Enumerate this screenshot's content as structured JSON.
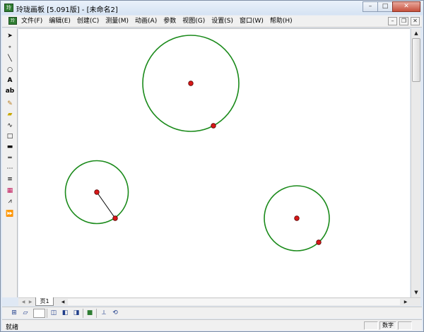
{
  "window": {
    "title": "玲珑画板 [5.091版] - [未命名2]",
    "app_icon": "app-logo-icon",
    "controls": [
      "minimize-icon",
      "maximize-icon",
      "close-icon"
    ]
  },
  "menubar": {
    "items": [
      {
        "label": "文件(F)"
      },
      {
        "label": "编辑(E)"
      },
      {
        "label": "创建(C)"
      },
      {
        "label": "测量(M)"
      },
      {
        "label": "动画(A)"
      },
      {
        "label": "参数"
      },
      {
        "label": "视图(G)"
      },
      {
        "label": "设置(S)"
      },
      {
        "label": "窗口(W)"
      },
      {
        "label": "帮助(H)"
      }
    ]
  },
  "toolbox": {
    "tools": [
      {
        "name": "select-arrow-icon",
        "glyph": "➤"
      },
      {
        "name": "point-tool-icon",
        "glyph": "∘"
      },
      {
        "name": "line-tool-icon",
        "glyph": "╲"
      },
      {
        "name": "circle-tool-icon",
        "glyph": "○"
      },
      {
        "name": "text-tool-icon",
        "glyph": "A"
      },
      {
        "name": "label-tool-icon",
        "glyph": "ab"
      },
      {
        "name": "pencil-tool-icon",
        "glyph": "✎"
      },
      {
        "name": "eraser-tool-icon",
        "glyph": "▰"
      },
      {
        "name": "polyline-tool-icon",
        "glyph": "∿"
      },
      {
        "name": "rectangle-tool-icon",
        "glyph": "□"
      },
      {
        "name": "thick-line-icon",
        "glyph": "▬"
      },
      {
        "name": "double-line-icon",
        "glyph": "═"
      },
      {
        "name": "dotted-line-icon",
        "glyph": "⋯"
      },
      {
        "name": "triple-line-icon",
        "glyph": "≡"
      },
      {
        "name": "color-palette-icon",
        "glyph": "▦"
      },
      {
        "name": "function-graph-icon",
        "glyph": "⩘"
      },
      {
        "name": "animation-play-icon",
        "glyph": "⏩"
      }
    ]
  },
  "canvas": {
    "circle_color": "#1a8a1a",
    "point_color": "#d81818"
  },
  "page_tabs": {
    "active": "页1"
  },
  "bottom_toolbar": {
    "tools": [
      {
        "name": "grid-icon",
        "glyph": "⊞"
      },
      {
        "name": "parallelogram-icon",
        "glyph": "▱"
      },
      {
        "name": "cube-front-icon",
        "glyph": "◫"
      },
      {
        "name": "cube-side-icon",
        "glyph": "◧"
      },
      {
        "name": "cube-top-icon",
        "glyph": "◨"
      },
      {
        "name": "fill-color-icon",
        "glyph": "■"
      },
      {
        "name": "coordinate-axes-icon",
        "glyph": "⟂"
      },
      {
        "name": "transform-icon",
        "glyph": "⟲"
      }
    ]
  },
  "statusbar": {
    "text": "就绪",
    "indicator": "数字"
  }
}
